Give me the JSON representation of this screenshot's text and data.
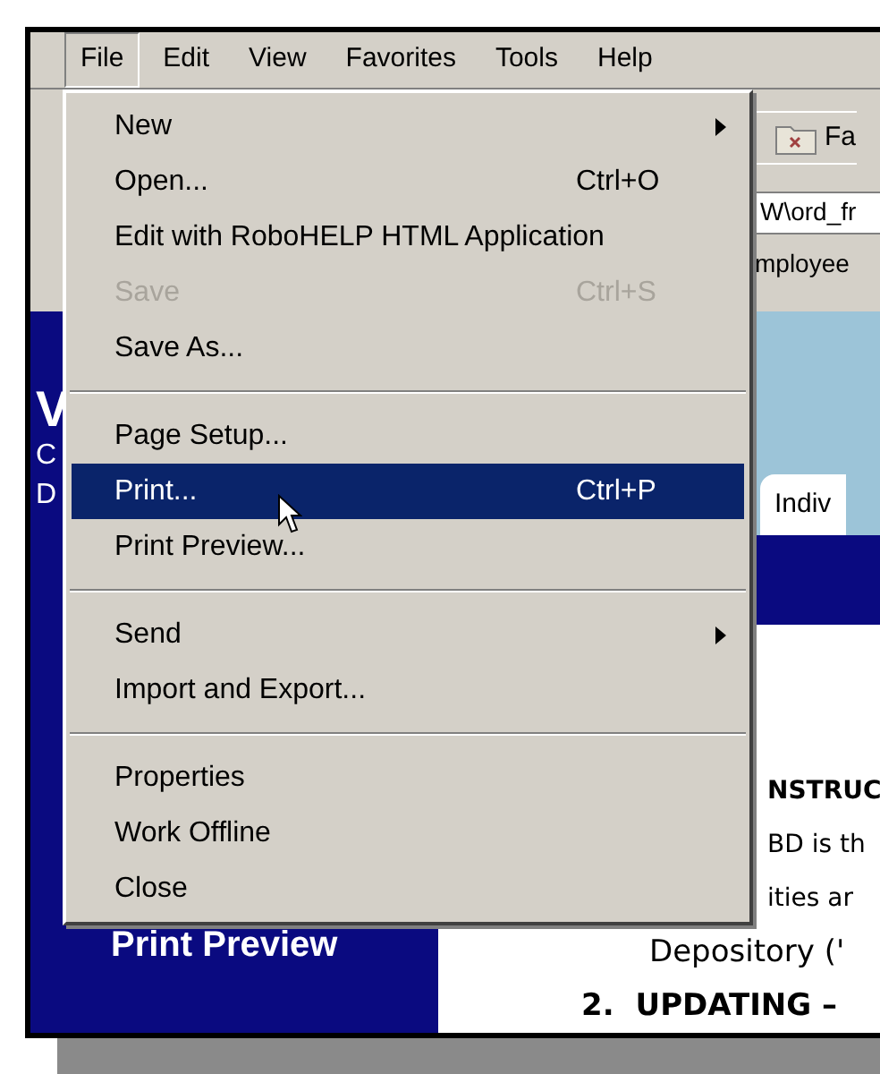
{
  "menubar": [
    {
      "label": "File",
      "selected": true
    },
    {
      "label": "Edit",
      "selected": false
    },
    {
      "label": "View",
      "selected": false
    },
    {
      "label": "Favorites",
      "selected": false
    },
    {
      "label": "Tools",
      "selected": false
    },
    {
      "label": "Help",
      "selected": false
    }
  ],
  "file_menu": [
    {
      "kind": "item",
      "label": "New",
      "submenu": true,
      "disabled": false,
      "selected": false
    },
    {
      "kind": "item",
      "label": "Open...",
      "shortcut": "Ctrl+O",
      "submenu": false,
      "disabled": false,
      "selected": false
    },
    {
      "kind": "item",
      "label": "Edit with RoboHELP HTML Application",
      "submenu": false,
      "disabled": false,
      "selected": false
    },
    {
      "kind": "item",
      "label": "Save",
      "shortcut": "Ctrl+S",
      "submenu": false,
      "disabled": true,
      "selected": false
    },
    {
      "kind": "item",
      "label": "Save As...",
      "submenu": false,
      "disabled": false,
      "selected": false
    },
    {
      "kind": "separator"
    },
    {
      "kind": "item",
      "label": "Page Setup...",
      "submenu": false,
      "disabled": false,
      "selected": false
    },
    {
      "kind": "item",
      "label": "Print...",
      "shortcut": "Ctrl+P",
      "submenu": false,
      "disabled": false,
      "selected": true
    },
    {
      "kind": "item",
      "label": "Print Preview...",
      "submenu": false,
      "disabled": false,
      "selected": false
    },
    {
      "kind": "separator"
    },
    {
      "kind": "item",
      "label": "Send",
      "submenu": true,
      "disabled": false,
      "selected": false
    },
    {
      "kind": "item",
      "label": "Import and Export...",
      "submenu": false,
      "disabled": false,
      "selected": false
    },
    {
      "kind": "separator"
    },
    {
      "kind": "item",
      "label": "Properties",
      "submenu": false,
      "disabled": false,
      "selected": false
    },
    {
      "kind": "item",
      "label": "Work Offline",
      "submenu": false,
      "disabled": false,
      "selected": false
    },
    {
      "kind": "item",
      "label": "Close",
      "submenu": false,
      "disabled": false,
      "selected": false
    }
  ],
  "toolbar": {
    "button": "Fa",
    "address": "W\\ord_fr",
    "link": "mployee"
  },
  "sidebar": {
    "letters": [
      "V",
      "C",
      "D"
    ],
    "link": "Print Preview"
  },
  "page": {
    "tab": "Indiv",
    "lines": [
      "NSTRUC",
      "BD is th",
      "ities ar",
      "Depository ('"
    ],
    "numbered": {
      "number": "2.",
      "text": "UPDATING –"
    }
  }
}
